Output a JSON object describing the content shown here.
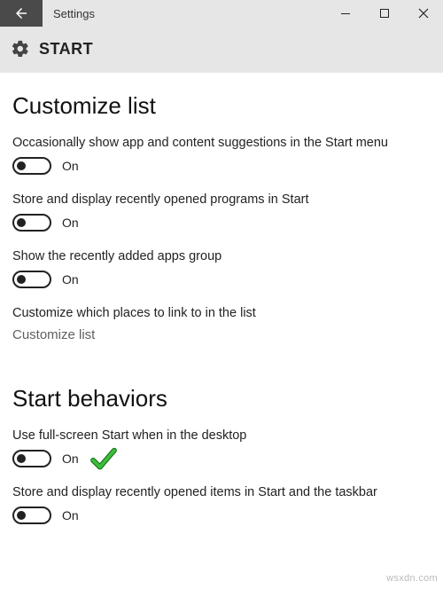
{
  "window": {
    "app_title": "Settings"
  },
  "header": {
    "page_title": "START"
  },
  "sections": {
    "customize": {
      "heading": "Customize list",
      "items": [
        {
          "label": "Occasionally show app and content suggestions in the Start menu",
          "state": "On"
        },
        {
          "label": "Store and display recently opened programs in Start",
          "state": "On"
        },
        {
          "label": "Show the recently added apps group",
          "state": "On"
        }
      ],
      "link_label": "Customize which places to link to in the list",
      "link_text": "Customize list"
    },
    "behaviors": {
      "heading": "Start behaviors",
      "items": [
        {
          "label": "Use full-screen Start when in the desktop",
          "state": "On"
        },
        {
          "label": "Store and display recently opened items in Start and the taskbar",
          "state": "On"
        }
      ]
    }
  },
  "watermark": "wsxdn.com"
}
